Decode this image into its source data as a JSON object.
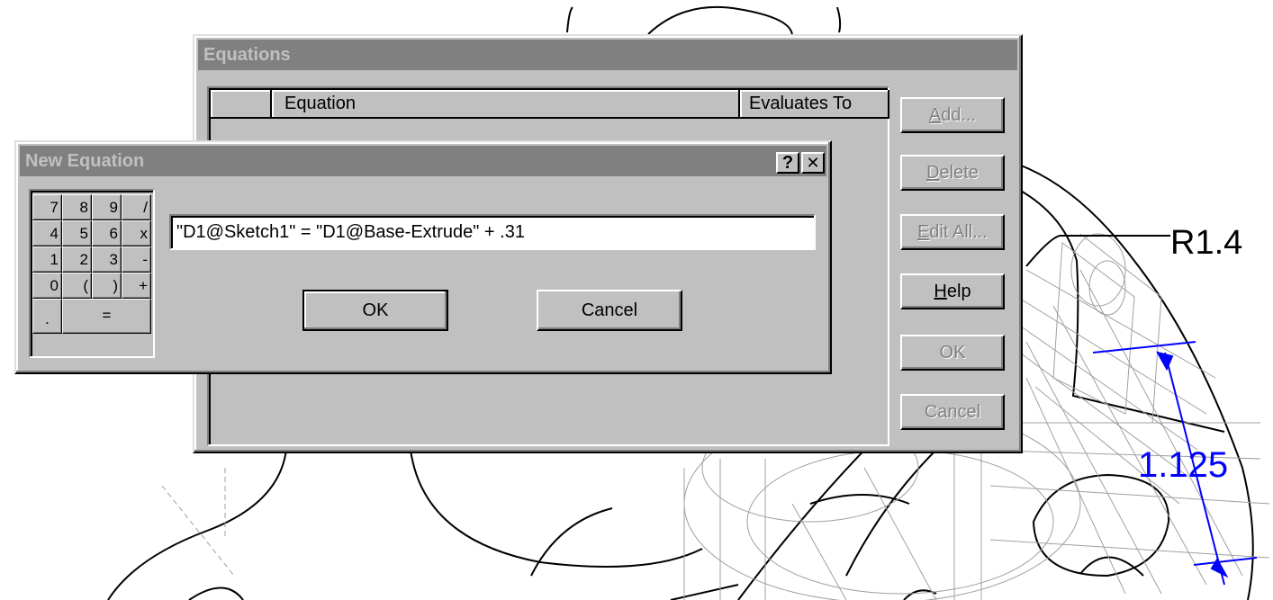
{
  "cad_view": {
    "radius_label": "R1.4",
    "dimension_value": "1.125",
    "dimension_color": "#0000ff"
  },
  "equations_dialog": {
    "title": "Equations",
    "columns": [
      "",
      "Equation",
      "Evaluates To"
    ],
    "buttons": {
      "add": {
        "mnemonic": "A",
        "rest": "dd..."
      },
      "delete": {
        "mnemonic": "D",
        "rest": "elete"
      },
      "edit_all": {
        "mnemonic": "E",
        "rest": "dit All..."
      },
      "help": {
        "mnemonic": "H",
        "rest": "elp"
      },
      "ok": "OK",
      "cancel": "Cancel"
    }
  },
  "new_equation_dialog": {
    "title": "New Equation",
    "help_glyph": "?",
    "close_glyph": "✕",
    "keypad": {
      "rows": [
        [
          "7",
          "8",
          "9",
          "/"
        ],
        [
          "4",
          "5",
          "6",
          "x"
        ],
        [
          "1",
          "2",
          "3",
          "-"
        ],
        [
          "0",
          "(",
          ")",
          "+"
        ]
      ],
      "decimal": ".",
      "equals": "="
    },
    "equation_value": "\"D1@Sketch1\" = \"D1@Base-Extrude\" + .31",
    "ok_label": "OK",
    "cancel_label": "Cancel"
  }
}
